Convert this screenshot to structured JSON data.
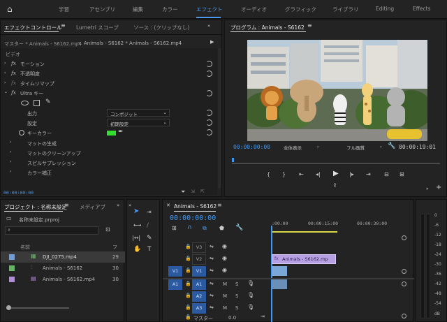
{
  "workspaces": [
    "学習",
    "アセンブリ",
    "編集",
    "カラー",
    "エフェクト",
    "オーディオ",
    "グラフィック",
    "ライブラリ",
    "Editing",
    "Effects"
  ],
  "active_workspace": "エフェクト",
  "effect_controls": {
    "tabs": [
      "エフェクトコントロール",
      "Lumetri スコープ",
      "ソース : (クリップなし)"
    ],
    "master_label": "マスター * Animals - S6162.mp4",
    "clip_label": "Animals - S6162 * Animals - S6162.mp4",
    "section": "ビデオ",
    "effects": [
      "モーション",
      "不透明度",
      "タイムリマップ",
      "Ultra キー"
    ],
    "output_label": "出力",
    "output_value": "コンポジット",
    "setting_label": "設定",
    "setting_value": "初期設定",
    "key_color_label": "キーカラー",
    "key_color": "#33dd33",
    "subgroups": [
      "マットの生成",
      "マットのクリーンアップ",
      "スピルサプレッション",
      "カラー補正"
    ],
    "timecode": "00:00:00:00"
  },
  "program": {
    "title": "プログラム : Animals - S6162",
    "timecode": "00:00:00:00",
    "zoom": "全体表示",
    "quality": "フル画質",
    "duration": "00:00:19:01"
  },
  "project": {
    "tabs": [
      "プロジェクト : 名称未設定",
      "メディアブ"
    ],
    "file": "名称未設定.prproj",
    "column_name": "名前",
    "column_fps": "フ",
    "items": [
      {
        "name": "DJI_0275.mp4",
        "fps": "29",
        "color": "#6f9fd6",
        "highlighted": true
      },
      {
        "name": "Animals - S6162",
        "fps": "30",
        "color": "#63b463",
        "highlighted": false
      },
      {
        "name": "Animals - S6162.mp4",
        "fps": "30",
        "color": "#b08ed8",
        "highlighted": false
      }
    ]
  },
  "timeline": {
    "title": "Animals - S6162",
    "timecode": "00:00:00:00",
    "ruler": [
      ":00:00",
      "00:00:15:00",
      "00:00:30:00"
    ],
    "video_tracks": [
      "V3",
      "V2",
      "V1"
    ],
    "audio_tracks": [
      "A1",
      "A2",
      "A3"
    ],
    "source_v": "V1",
    "source_a": "A1",
    "clip_label": "Animals - S6162.mp",
    "master_label": "マスター",
    "master_value": "0.0",
    "mute": "M",
    "solo": "S"
  },
  "meter": {
    "scale": [
      "0",
      "-6",
      "-12",
      "-18",
      "-24",
      "-30",
      "-36",
      "-42",
      "-48",
      "-54",
      "dB"
    ]
  }
}
